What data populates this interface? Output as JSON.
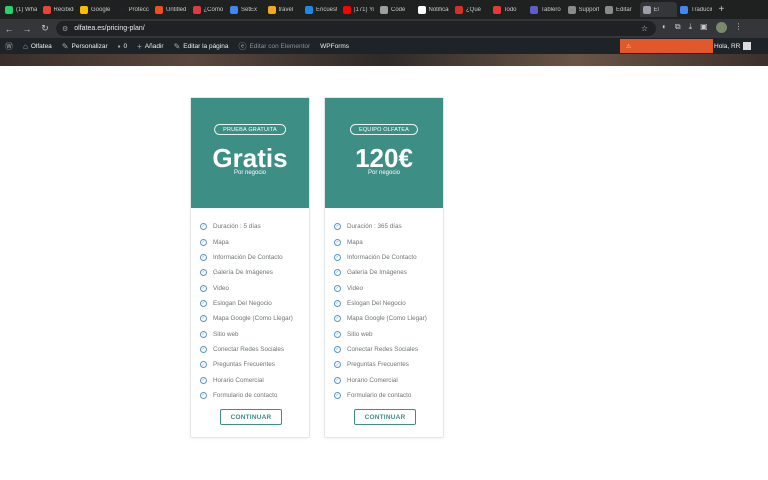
{
  "browser": {
    "tabs": [
      {
        "title": "(1) WhatsApp",
        "color": "#25d366"
      },
      {
        "title": "Recibidos",
        "color": "#ea4335"
      },
      {
        "title": "Google Drive",
        "color": "#fbbc04"
      },
      {
        "title": "Protección",
        "color": "#202124"
      },
      {
        "title": "Untitled",
        "color": "#f24e1e"
      },
      {
        "title": "¿Cómo",
        "color": "#e0393e"
      },
      {
        "title": "SetEx",
        "color": "#4285f4"
      },
      {
        "title": "travel",
        "color": "#f5a623"
      },
      {
        "title": "Encuesta",
        "color": "#1e88e5"
      },
      {
        "title": "(171) YouTube",
        "color": "#ff0000"
      },
      {
        "title": "Code",
        "color": "#9e9e9e"
      },
      {
        "title": "Notificaciones",
        "color": "#ffffff"
      },
      {
        "title": "¿Qué",
        "color": "#d93025"
      },
      {
        "title": "Todo",
        "color": "#e53935"
      },
      {
        "title": "Tablero",
        "color": "#5b5fc7"
      },
      {
        "title": "Support",
        "color": "#8a8a8a"
      },
      {
        "title": "Editar",
        "color": "#8a8a8a"
      },
      {
        "title": "El",
        "color": "#9aa0a6"
      },
      {
        "title": "Traducir",
        "color": "#4285f4"
      }
    ],
    "active_tab": 17,
    "new_tab": "+",
    "url": "olfatea.es/pricing-plan/"
  },
  "wp_admin_bar": {
    "site_name": "Olfatea",
    "customize": "Personalizar",
    "comments_count": "0",
    "add_new": "Añadir",
    "edit_page": "Editar la página",
    "edit_elementor": "Editar con Elementor",
    "wpforms": "WPForms",
    "greeting": "Hola, RR"
  },
  "plans": [
    {
      "badge": "PRUEBA GRATUITA",
      "price": "Gratis",
      "per": "Por negocio",
      "features": [
        "Duración : 5 días",
        "Mapa",
        "Información De Contacto",
        "Galería De Imágenes",
        "Video",
        "Eslogan Del Negocio",
        "Mapa Google (Como Llegar)",
        "Sitio web",
        "Conectar Redes Sociales",
        "Preguntas Frecuentes",
        "Horario Comercial",
        "Formulario de contacto"
      ],
      "cta": "CONTINUAR"
    },
    {
      "badge": "EQUIPO OLFATEA",
      "price": "120€",
      "per": "Por negocio",
      "features": [
        "Duración : 365 días",
        "Mapa",
        "Información De Contacto",
        "Galería De Imágenes",
        "Video",
        "Eslogan Del Negocio",
        "Mapa Google (Como Llegar)",
        "Sitio web",
        "Conectar Redes Sociales",
        "Preguntas Frecuentes",
        "Horario Comercial",
        "Formulario de contacto"
      ],
      "cta": "CONTINUAR"
    }
  ],
  "colors": {
    "plan_header": "#3d8f86",
    "check_icon": "#5a97c9",
    "admin_alert": "#e2582b"
  }
}
